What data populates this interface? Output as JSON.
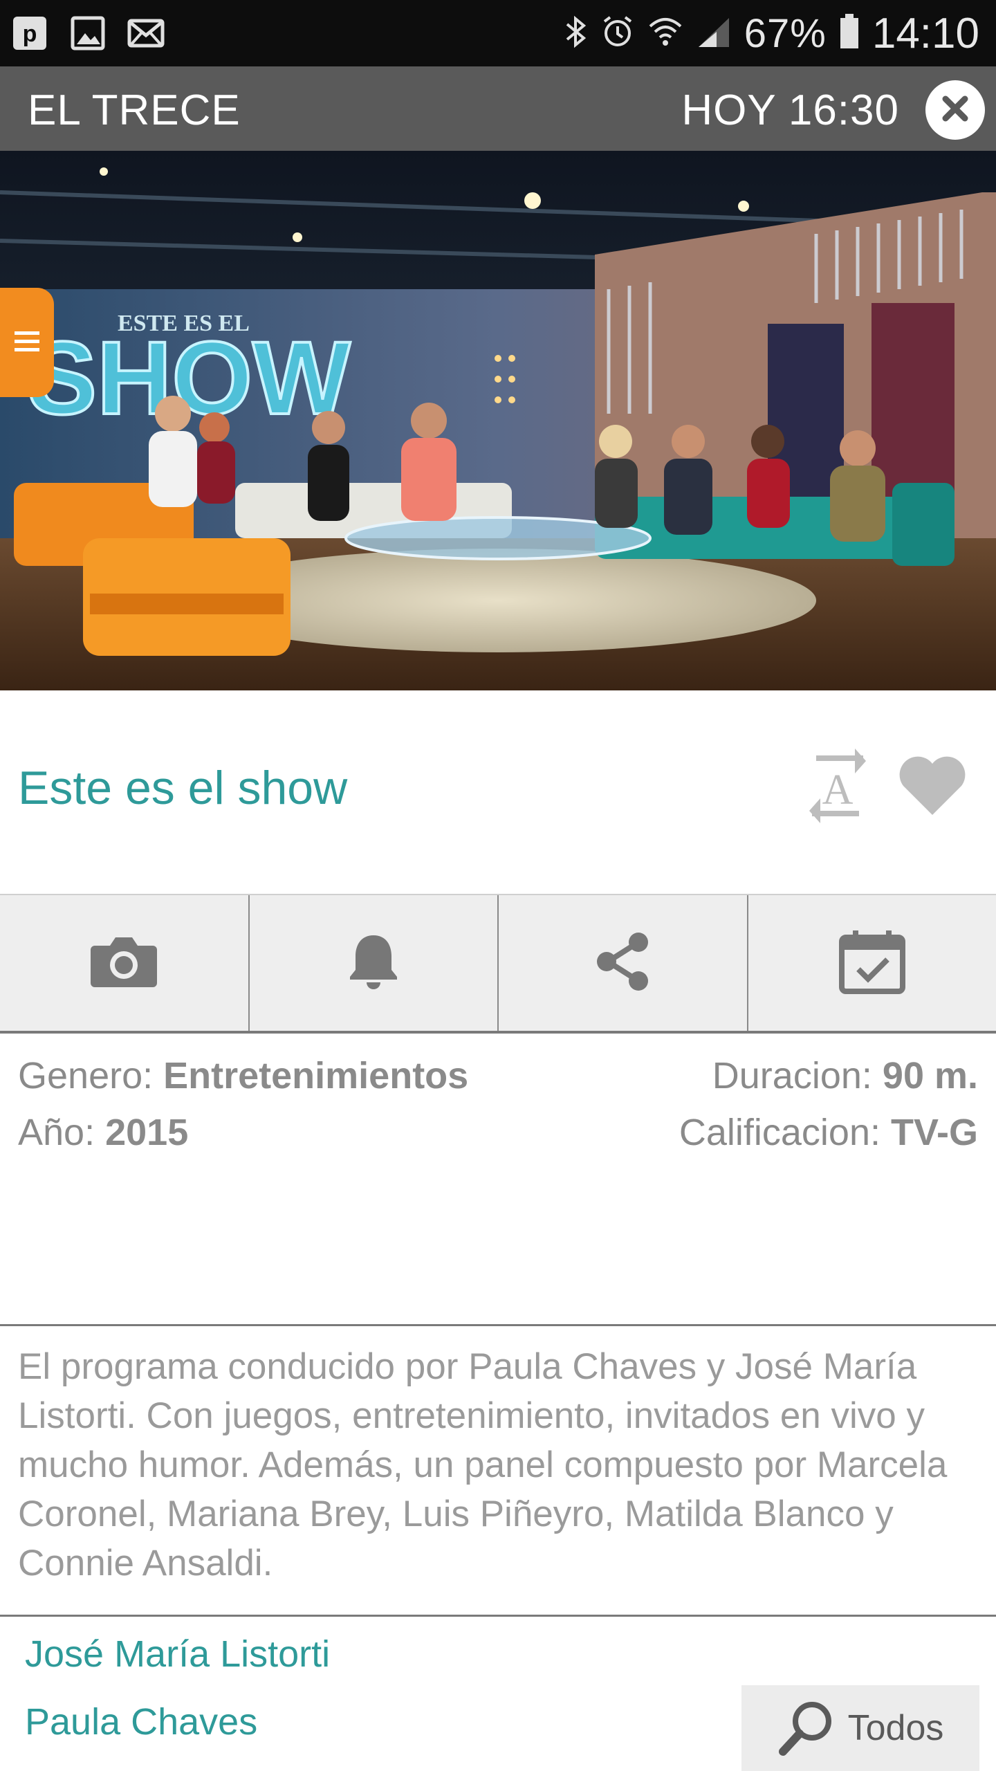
{
  "status_bar": {
    "battery": "67%",
    "time": "14:10",
    "left_icons": [
      "pinterest-icon",
      "image-icon",
      "mail-icon"
    ],
    "right_icons": [
      "bluetooth-icon",
      "alarm-icon",
      "wifi-icon",
      "signal-icon",
      "battery-icon"
    ]
  },
  "header": {
    "channel": "EL TRECE",
    "airtime": "HOY 16:30"
  },
  "show": {
    "title": "Este es el show",
    "hero_sign": "ESTE ES EL SHOW"
  },
  "actions": [
    {
      "name": "camera",
      "icon": "camera-icon"
    },
    {
      "name": "reminder",
      "icon": "bell-icon"
    },
    {
      "name": "share",
      "icon": "share-icon"
    },
    {
      "name": "calendar",
      "icon": "calendar-check-icon"
    }
  ],
  "details": {
    "genre_label": "Genero: ",
    "genre_value": "Entretenimientos",
    "year_label": "Año: ",
    "year_value": "2015",
    "duration_label": "Duracion: ",
    "duration_value": "90 m.",
    "rating_label": "Calificacion: ",
    "rating_value": "TV-G"
  },
  "description": "El programa conducido por Paula Chaves y José María Listorti. Con juegos, entretenimiento, invitados en vivo y mucho humor. Además, un panel compuesto por Marcela Coronel, Mariana Brey, Luis Piñeyro, Matilda Blanco y Connie Ansaldi.",
  "cast": [
    "José María Listorti",
    "Paula Chaves"
  ],
  "todos_button": "Todos",
  "colors": {
    "accent": "#2e9a99",
    "header_bg": "#5a5a5a",
    "status_bg": "#0d0d0d",
    "side_tab": "#f28c1f",
    "muted_text": "#8a8a8a"
  }
}
